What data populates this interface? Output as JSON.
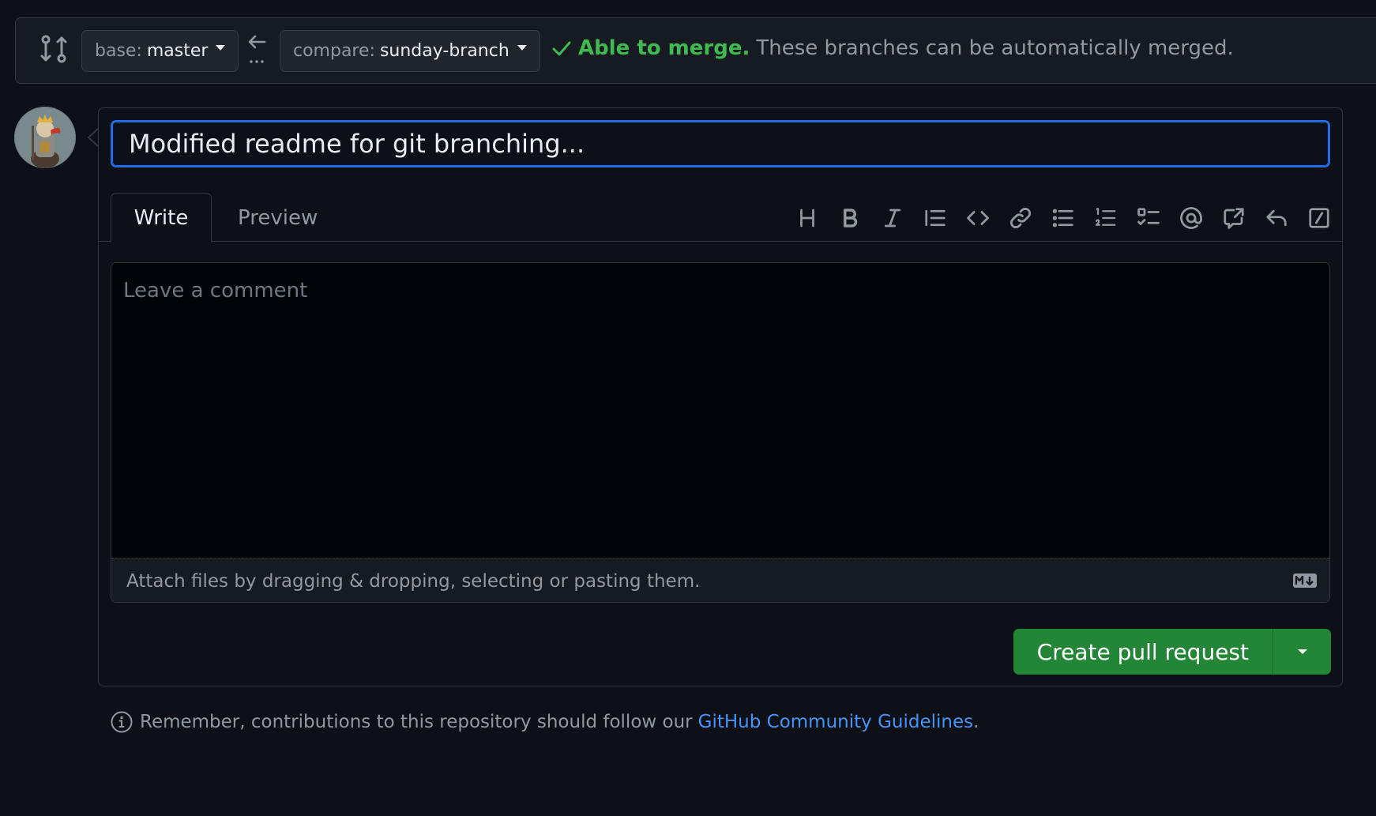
{
  "range": {
    "base_prefix": "base:",
    "base_branch": "master",
    "compare_prefix": "compare:",
    "compare_branch": "sunday-branch",
    "merge_ok": "Able to merge.",
    "merge_desc": "These branches can be automatically merged."
  },
  "pr": {
    "title_value": "Modified readme for git branching...",
    "tabs": [
      {
        "label": "Write",
        "active": true
      },
      {
        "label": "Preview",
        "active": false
      }
    ],
    "toolbar_icons": [
      "heading-icon",
      "bold-icon",
      "italic-icon",
      "quote-icon",
      "code-icon",
      "link-icon",
      "unordered-list-icon",
      "ordered-list-icon",
      "task-list-icon",
      "mention-icon",
      "cross-reference-icon",
      "undo-icon",
      "slash-command-icon"
    ],
    "comment_placeholder": "Leave a comment",
    "attach_text": "Attach files by dragging & dropping, selecting or pasting them.",
    "submit_label": "Create pull request"
  },
  "footer": {
    "text": "Remember, contributions to this repository should follow our",
    "link": "GitHub Community Guidelines",
    "suffix": "."
  },
  "colors": {
    "background": "#0d1117",
    "success_green": "#3fb950",
    "button_green": "#238636",
    "focus_blue": "#1f6feb",
    "link_blue": "#4493f8"
  }
}
